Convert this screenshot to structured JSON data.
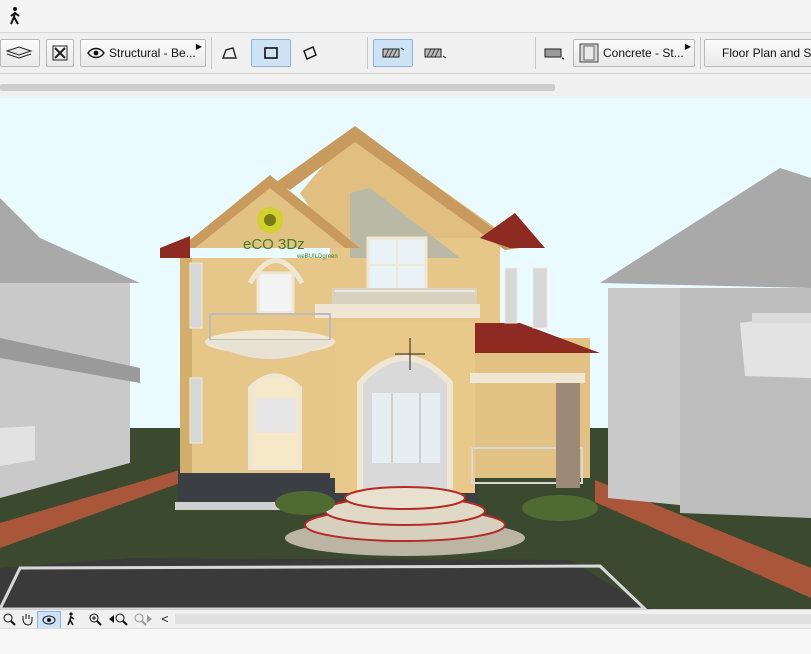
{
  "topbar": {
    "walk_icon": "walk-person-icon"
  },
  "toolbar": {
    "layer_view_label": "Structural - Be...",
    "material_label": "Concrete - St...",
    "view_label": "Floor Plan and Sec"
  },
  "viewport": {
    "watermark_title": "eCO 3Dz",
    "watermark_sub": "weBUILDgreen"
  },
  "bottombar": {
    "zoom_buttons": [
      "zoom-icon",
      "hand-pan-icon",
      "orbit-icon",
      "walk-icon",
      "zoom-in-icon",
      "zoom-prev-icon",
      "zoom-next-icon"
    ],
    "scroll_left": "<"
  },
  "colors": {
    "sky": "#e9fbff",
    "wall_yellow": "#e8c98a",
    "roof_red": "#8d2b22",
    "trim": "#efe7d4",
    "neighbor_gray": "#c9c9c9",
    "grass": "#3b4a2f",
    "brick": "#a9563a"
  }
}
